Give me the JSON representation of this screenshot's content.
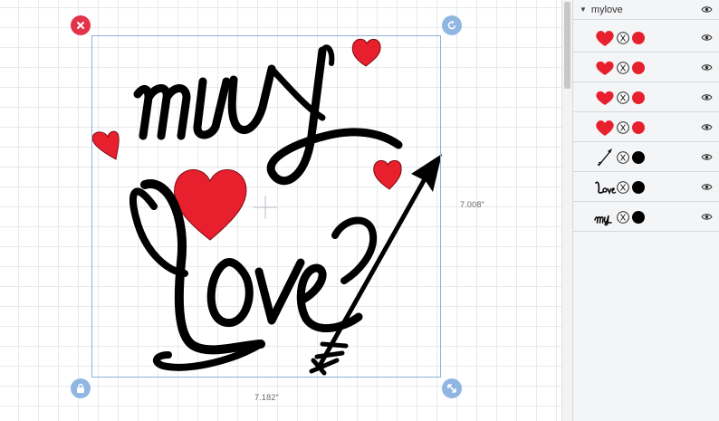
{
  "canvas": {
    "height_label": "7.008\"",
    "width_label": "7.182\""
  },
  "design": {
    "word1": "my",
    "word2": "Love",
    "heart_color": "#e8202e",
    "ink_color": "#000000"
  },
  "panel": {
    "group_name": "mylove",
    "layers": [
      {
        "name": "heart",
        "color": "#e8202e"
      },
      {
        "name": "heart",
        "color": "#e8202e"
      },
      {
        "name": "heart",
        "color": "#e8202e"
      },
      {
        "name": "heart",
        "color": "#e8202e"
      },
      {
        "name": "arrow",
        "color": "#000000"
      },
      {
        "name": "Love",
        "color": "#000000"
      },
      {
        "name": "my",
        "color": "#000000"
      }
    ]
  },
  "icons": {
    "close": "close-icon",
    "rotate": "rotate-icon",
    "lock": "lock-icon",
    "resize": "resize-icon",
    "visibility": "eye-icon",
    "cut": "scissors-icon"
  }
}
